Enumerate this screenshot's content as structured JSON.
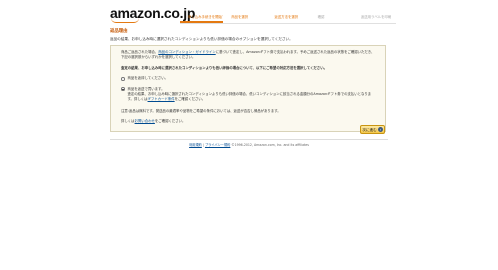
{
  "header": {
    "logo_text": "amazon.co.jp",
    "steps": [
      {
        "label": "申し込み手続きを開始する",
        "state": "active"
      },
      {
        "label": "商品を選択",
        "state": "done"
      },
      {
        "label": "返送方法を選択",
        "state": "done"
      },
      {
        "label": "確認",
        "state": "pending"
      },
      {
        "label": "返送用ラベルを印刷",
        "state": "pending"
      }
    ]
  },
  "title": "返品理由",
  "intro": "返品の結果、お申し込み時に選択されたコンディションよりも低い評価の場合のオプションを選択してください。",
  "panel": {
    "p1_before_link": "商品ご返品された場合、",
    "p1_link": "商品のコンディション・ガイドライン",
    "p1_after_link": "に基づいて査定し、Amazonギフト券で支払われます。予めご返送された返品の状態をご確認いただき、下記の選択肢からいずれかを選択してください。",
    "p2_bold": "査定の結果、お申し込み時に選択されたコンディションよりも低い評価の場合について、以下にご希望の対応方法を選択してください。",
    "option1_label": "商品を返却してください。",
    "option2_label": "商品を返送で買います。",
    "option2_sub_before": "査定の結果、お申し込み時に選択されたコンディションよりも低い評価の場合、低いコンディションに該当される金額分のAmazonギフト券での支払いとなります。詳しくは",
    "option2_sub_link": "ギフトカード条件",
    "option2_sub_after": "をご確認ください。",
    "note": "注意:返品は無料です。発送品の最適率や品物をご希望の条件においては、返送が否否し帰品があります。",
    "back_prefix": "詳しくは",
    "back_link": "お問い合わせ",
    "back_suffix": "をご確認ください。"
  },
  "next_button": {
    "label": "次に進む",
    "arrow": "›"
  },
  "footer": {
    "link1": "利用規約",
    "separator": "|",
    "link2": "プライバシー規約",
    "copyright": "©1996-2012, Amazon.com, Inc. and its affiliates"
  }
}
